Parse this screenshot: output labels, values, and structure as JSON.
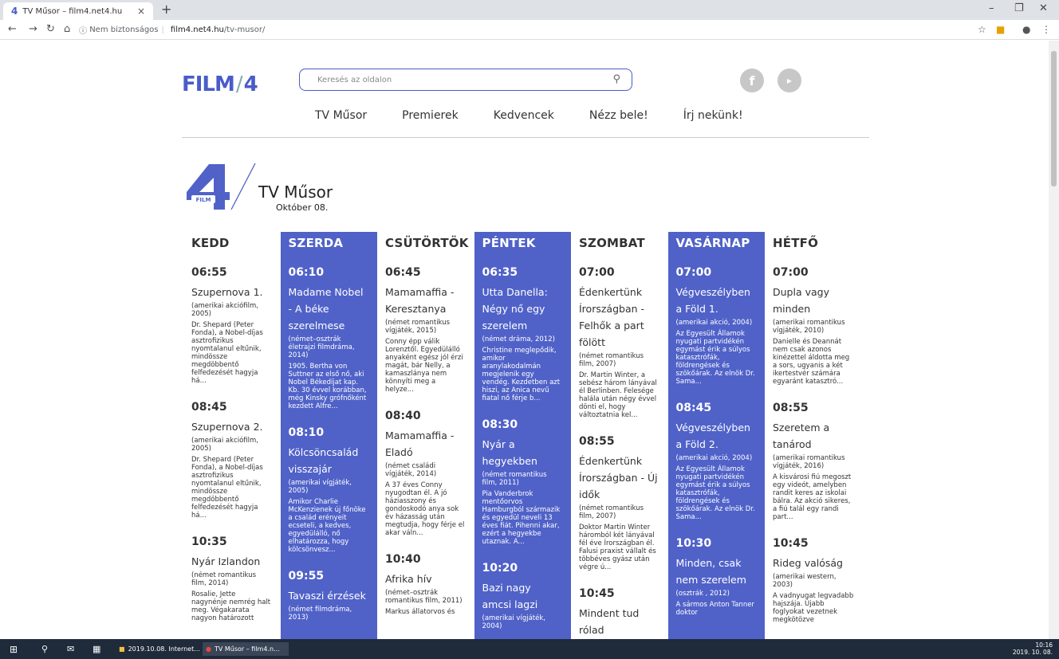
{
  "browser": {
    "tab_title": "TV Műsor – film4.net4.hu",
    "url_secure_label": "Nem biztonságos",
    "url_domain": "film4.net4.hu",
    "url_path": "/tv-musor/"
  },
  "header": {
    "logo_text_left": "FILM",
    "logo_text_right": "4",
    "search_placeholder": "Keresés az oldalon",
    "nav": [
      "TV Műsor",
      "Premierek",
      "Kedvencek",
      "Nézz bele!",
      "Írj nekünk!"
    ]
  },
  "page": {
    "title": "TV Műsor",
    "date": "Október 08.",
    "badge_label": "FILM"
  },
  "accent_color": "#5062c8",
  "schedule": [
    {
      "day": "KEDD",
      "highlight": false,
      "shows": [
        {
          "time": "06:55",
          "title": "Szupernova 1.",
          "meta": "(amerikai akciófilm, 2005)",
          "desc": "Dr. Shepard (Peter Fonda), a Nobel-díjas asztrofizikus nyomtalanul eltűnik, mindössze megdöbbentő felfedezését hagyja há..."
        },
        {
          "time": "08:45",
          "title": "Szupernova 2.",
          "meta": "(amerikai akciófilm, 2005)",
          "desc": "Dr. Shepard (Peter Fonda), a Nobel-díjas asztrofizikus nyomtalanul eltűnik, mindössze megdöbbentő felfedezését hagyja há..."
        },
        {
          "time": "10:35",
          "title": "Nyár Izlandon",
          "meta": "(német romantikus film, 2014)",
          "desc": "Rosalie, Jette nagynénje nemrég halt meg. Végakarata nagyon határozott"
        }
      ]
    },
    {
      "day": "SZERDA",
      "highlight": true,
      "shows": [
        {
          "time": "06:10",
          "title": "Madame Nobel - A béke szerelmese",
          "meta": "(német–osztrák életrajzi filmdráma, 2014)",
          "desc": "1905. Bertha von Suttner az első nő, aki Nobel Békedíjat kap. Kb. 30 évvel korábban, még Kinsky grófnőként kezdett Alfre..."
        },
        {
          "time": "08:10",
          "title": "Kölcsöncsalád visszajár",
          "meta": "(amerikai vígjáték, 2005)",
          "desc": "Amikor Charlie McKenzienek új főnöke a család erényeit ecseteli, a kedves, egyedülálló, nő elhatározza, hogy kölcsönvesz..."
        },
        {
          "time": "09:55",
          "title": "Tavaszi érzések",
          "meta": "(német filmdráma, 2013)",
          "desc": ""
        }
      ]
    },
    {
      "day": "CSÜTÖRTÖK",
      "highlight": false,
      "shows": [
        {
          "time": "06:45",
          "title": "Mamamaffia - Keresztanya",
          "meta": "(német romantikus vígjáték, 2015)",
          "desc": "Conny épp válik Lorenztől. Egyedülálló anyaként egész jól érzi magát, bár Nelly, a kamaszlánya nem könnyíti meg a helyze..."
        },
        {
          "time": "08:40",
          "title": "Mamamaffia - Eladó",
          "meta": "(német családi vígjáték, 2014)",
          "desc": "A 37 éves Conny nyugodtan él. A jó háziasszony és gondoskodó anya sok év házasság után megtudja, hogy férje el akar váln..."
        },
        {
          "time": "10:40",
          "title": "Afrika hív",
          "meta": "(német–osztrák romantikus film, 2011)",
          "desc": "Markus állatorvos és"
        }
      ]
    },
    {
      "day": "PÉNTEK",
      "highlight": true,
      "shows": [
        {
          "time": "06:35",
          "title": "Utta Danella: Négy nő egy szerelem",
          "meta": "(német dráma, 2012)",
          "desc": "Christine meglepődik, amikor aranylakodalmán megjelenik egy vendég. Kezdetben azt hiszi, az Anica nevű fiatal nő férje b..."
        },
        {
          "time": "08:30",
          "title": "Nyár a hegyekben",
          "meta": "(német romantikus film, 2011)",
          "desc": "Pia Vanderbrok mentőorvos Hamburgból származik és egyedül neveli 13 éves fiát. Pihenni akar, ezért a hegyekbe utaznak. A..."
        },
        {
          "time": "10:20",
          "title": "Bazi nagy amcsi lagzi",
          "meta": "(amerikai vígjáték, 2004)",
          "desc": ""
        }
      ]
    },
    {
      "day": "SZOMBAT",
      "highlight": false,
      "shows": [
        {
          "time": "07:00",
          "title": "Édenkertünk Írországban - Felhők a part fölött",
          "meta": "(német romantikus film, 2007)",
          "desc": "Dr. Martin Winter, a sebész három lányával él Berlinben. Felesége halála után négy évvel dönti el, hogy változtatnia kel..."
        },
        {
          "time": "08:55",
          "title": "Édenkertünk Írországban - Új idők",
          "meta": "(német romantikus film, 2007)",
          "desc": "Doktor Martin Winter háromból két lányával fél éve Írországban él. Falusi praxist vállalt és többéves gyász után végre ú..."
        },
        {
          "time": "10:45",
          "title": "Mindent tud rólad",
          "meta": "",
          "desc": ""
        }
      ]
    },
    {
      "day": "VASÁRNAP",
      "highlight": true,
      "shows": [
        {
          "time": "07:00",
          "title": "Végveszélyben a Föld 1.",
          "meta": "(amerikai akció, 2004)",
          "desc": "Az Egyesült Államok nyugati partvidékén egymást érik a súlyos katasztrófák, földrengések és szökőárak. Az elnök Dr. Sama..."
        },
        {
          "time": "08:45",
          "title": "Végveszélyben a Föld 2.",
          "meta": "(amerikai akció, 2004)",
          "desc": "Az Egyesült Államok nyugati partvidékén egymást érik a súlyos katasztrófák, földrengések és szökőárak. Az elnök Dr. Sama..."
        },
        {
          "time": "10:30",
          "title": "Minden, csak nem szerelem",
          "meta": "(osztrák , 2012)",
          "desc": "A sármos Anton Tanner doktor"
        }
      ]
    },
    {
      "day": "HÉTFŐ",
      "highlight": false,
      "shows": [
        {
          "time": "07:00",
          "title": "Dupla vagy minden",
          "meta": "(amerikai romantikus vígjáték, 2010)",
          "desc": "Danielle és Deannát nem csak azonos kinézettel áldotta meg a sors, ugyanis a két ikertestvér számára egyaránt katasztró..."
        },
        {
          "time": "08:55",
          "title": "Szeretem a tanárod",
          "meta": "(amerikai romantikus vígjáték, 2016)",
          "desc": "A kisvárosi fiú megoszt egy videót, amelyben randit keres az iskolai bálra. Az akció sikeres, a fiú talál egy randi part..."
        },
        {
          "time": "10:45",
          "title": "Rideg valóság",
          "meta": "(amerikai western, 2003)",
          "desc": "A vadnyugat legvadabb hajszája. Újabb foglyokat vezetnek megkötözve"
        }
      ]
    }
  ],
  "taskbar": {
    "item1": "2019.10.08. Internet...",
    "item2": "TV Műsor – film4.n...",
    "time": "10:16",
    "date": "2019. 10. 08."
  }
}
